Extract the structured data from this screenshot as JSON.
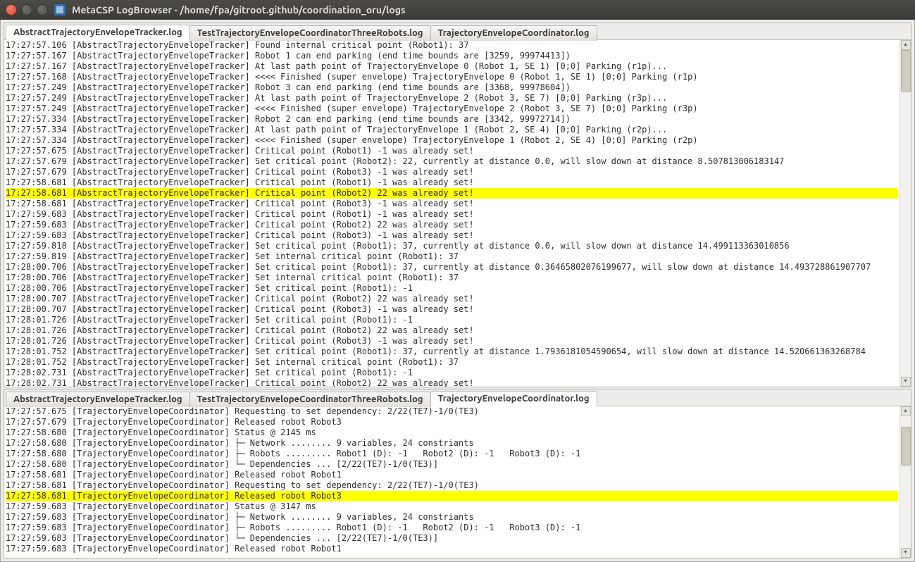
{
  "window": {
    "title": "MetaCSP LogBrowser - /home/fpa/gitroot.github/coordination_oru/logs"
  },
  "topPane": {
    "activeTab": 0,
    "tabs": [
      "AbstractTrajectoryEnvelopeTracker.log",
      "TestTrajectoryEnvelopeCoordinatorThreeRobots.log",
      "TrajectoryEnvelopeCoordinator.log"
    ],
    "highlightIndex": 14,
    "lines": [
      "17:27:57.106 [AbstractTrajectoryEnvelopeTracker] Found internal critical point (Robot1): 37",
      "17:27:57.167 [AbstractTrajectoryEnvelopeTracker] Robot 1 can end parking (end time bounds are [3259, 99974413])",
      "17:27:57.167 [AbstractTrajectoryEnvelopeTracker] At last path point of TrajectoryEnvelope 0 (Robot 1, SE 1) [0;0] Parking (r1p)...",
      "17:27:57.168 [AbstractTrajectoryEnvelopeTracker] <<<< Finished (super envelope) TrajectoryEnvelope 0 (Robot 1, SE 1) [0;0] Parking (r1p)",
      "17:27:57.249 [AbstractTrajectoryEnvelopeTracker] Robot 3 can end parking (end time bounds are [3368, 99978604])",
      "17:27:57.249 [AbstractTrajectoryEnvelopeTracker] At last path point of TrajectoryEnvelope 2 (Robot 3, SE 7) [0;0] Parking (r3p)...",
      "17:27:57.249 [AbstractTrajectoryEnvelopeTracker] <<<< Finished (super envelope) TrajectoryEnvelope 2 (Robot 3, SE 7) [0;0] Parking (r3p)",
      "17:27:57.334 [AbstractTrajectoryEnvelopeTracker] Robot 2 can end parking (end time bounds are [3342, 99972714])",
      "17:27:57.334 [AbstractTrajectoryEnvelopeTracker] At last path point of TrajectoryEnvelope 1 (Robot 2, SE 4) [0;0] Parking (r2p)...",
      "17:27:57.334 [AbstractTrajectoryEnvelopeTracker] <<<< Finished (super envelope) TrajectoryEnvelope 1 (Robot 2, SE 4) [0;0] Parking (r2p)",
      "17:27:57.675 [AbstractTrajectoryEnvelopeTracker] Critical point (Robot1) -1 was already set!",
      "17:27:57.679 [AbstractTrajectoryEnvelopeTracker] Set critical point (Robot2): 22, currently at distance 0.0, will slow down at distance 8.507813006183147",
      "17:27:57.679 [AbstractTrajectoryEnvelopeTracker] Critical point (Robot3) -1 was already set!",
      "17:27:58.681 [AbstractTrajectoryEnvelopeTracker] Critical point (Robot1) -1 was already set!",
      "17:27:58.681 [AbstractTrajectoryEnvelopeTracker] Critical point (Robot2) 22 was already set!",
      "17:27:58.681 [AbstractTrajectoryEnvelopeTracker] Critical point (Robot3) -1 was already set!",
      "17:27:59.683 [AbstractTrajectoryEnvelopeTracker] Critical point (Robot1) -1 was already set!",
      "17:27:59.683 [AbstractTrajectoryEnvelopeTracker] Critical point (Robot2) 22 was already set!",
      "17:27:59.683 [AbstractTrajectoryEnvelopeTracker] Critical point (Robot3) -1 was already set!",
      "17:27:59.818 [AbstractTrajectoryEnvelopeTracker] Set critical point (Robot1): 37, currently at distance 0.0, will slow down at distance 14.499113363010856",
      "17:27:59.819 [AbstractTrajectoryEnvelopeTracker] Set internal critical point (Robot1): 37",
      "17:28:00.706 [AbstractTrajectoryEnvelopeTracker] Set critical point (Robot1): 37, currently at distance 0.36465802076199677, will slow down at distance 14.493728861907707",
      "17:28:00.706 [AbstractTrajectoryEnvelopeTracker] Set internal critical point (Robot1): 37",
      "17:28:00.706 [AbstractTrajectoryEnvelopeTracker] Set critical point (Robot1): -1",
      "17:28:00.707 [AbstractTrajectoryEnvelopeTracker] Critical point (Robot2) 22 was already set!",
      "17:28:00.707 [AbstractTrajectoryEnvelopeTracker] Critical point (Robot3) -1 was already set!",
      "17:28:01.726 [AbstractTrajectoryEnvelopeTracker] Set critical point (Robot1): -1",
      "17:28:01.726 [AbstractTrajectoryEnvelopeTracker] Critical point (Robot2) 22 was already set!",
      "17:28:01.726 [AbstractTrajectoryEnvelopeTracker] Critical point (Robot3) -1 was already set!",
      "17:28:01.752 [AbstractTrajectoryEnvelopeTracker] Set critical point (Robot1): 37, currently at distance 1.7936181054590654, will slow down at distance 14.520661363268784",
      "17:28:01.752 [AbstractTrajectoryEnvelopeTracker] Set internal critical point (Robot1): 37",
      "17:28:02.731 [AbstractTrajectoryEnvelopeTracker] Set critical point (Robot1): -1",
      "17:28:02.731 [AbstractTrajectoryEnvelopeTracker] Critical point (Robot2) 22 was already set!"
    ]
  },
  "bottomPane": {
    "activeTab": 2,
    "tabs": [
      "AbstractTrajectoryEnvelopeTracker.log",
      "TestTrajectoryEnvelopeCoordinatorThreeRobots.log",
      "TrajectoryEnvelopeCoordinator.log"
    ],
    "highlightIndex": 8,
    "lines": [
      "17:27:57.675 [TrajectoryEnvelopeCoordinator] Requesting to set dependency: 2/22(TE7)-1/0(TE3)",
      "17:27:57.679 [TrajectoryEnvelopeCoordinator] Released robot Robot3",
      "17:27:58.680 [TrajectoryEnvelopeCoordinator] Status @ 2145 ms",
      "17:27:58.680 [TrajectoryEnvelopeCoordinator] ├─ Network ........ 9 variables, 24 constriants",
      "17:27:58.680 [TrajectoryEnvelopeCoordinator] ├─ Robots ......... Robot1 (D): -1   Robot2 (D): -1   Robot3 (D): -1",
      "17:27:58.680 [TrajectoryEnvelopeCoordinator] └─ Dependencies ... [2/22(TE7)-1/0(TE3)]",
      "17:27:58.681 [TrajectoryEnvelopeCoordinator] Released robot Robot1",
      "17:27:58.681 [TrajectoryEnvelopeCoordinator] Requesting to set dependency: 2/22(TE7)-1/0(TE3)",
      "17:27:58.681 [TrajectoryEnvelopeCoordinator] Released robot Robot3",
      "17:27:59.683 [TrajectoryEnvelopeCoordinator] Status @ 3147 ms",
      "17:27:59.683 [TrajectoryEnvelopeCoordinator] ├─ Network ........ 9 variables, 24 constriants",
      "17:27:59.683 [TrajectoryEnvelopeCoordinator] ├─ Robots ......... Robot1 (D): -1   Robot2 (D): -1   Robot3 (D): -1",
      "17:27:59.683 [TrajectoryEnvelopeCoordinator] └─ Dependencies ... [2/22(TE7)-1/0(TE3)]",
      "17:27:59.683 [TrajectoryEnvelopeCoordinator] Released robot Robot1"
    ]
  },
  "scrollbar": {
    "upGlyph": "▴",
    "downGlyph": "▾"
  }
}
